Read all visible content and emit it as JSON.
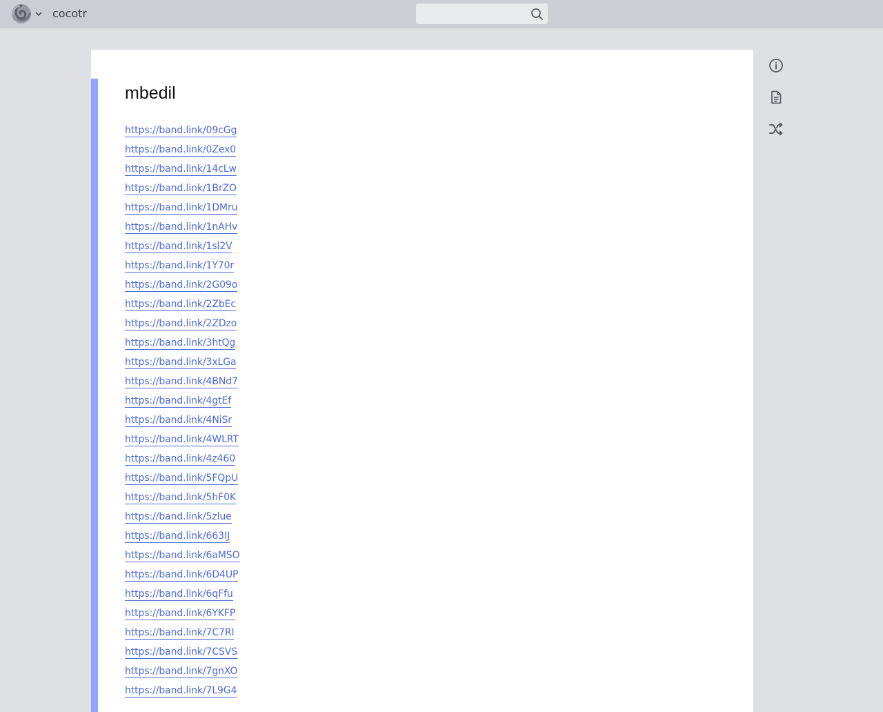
{
  "header": {
    "app_name": "cocotr",
    "logo_icon": "spiral-logo-icon",
    "menu_icon": "chevron-down-icon",
    "search": {
      "value": "",
      "placeholder": "",
      "icon": "search-icon"
    }
  },
  "page": {
    "title": "mbedil",
    "accent_color": "#8fa5ff",
    "link_color": "#4d6bd8",
    "links": [
      "https://band.link/09cGg",
      "https://band.link/0Zex0",
      "https://band.link/14cLw",
      "https://band.link/1BrZO",
      "https://band.link/1DMru",
      "https://band.link/1nAHv",
      "https://band.link/1sl2V",
      "https://band.link/1Y70r",
      "https://band.link/2G09o",
      "https://band.link/2ZbEc",
      "https://band.link/2ZDzo",
      "https://band.link/3htQg",
      "https://band.link/3xLGa",
      "https://band.link/4BNd7",
      "https://band.link/4gtEf",
      "https://band.link/4NiSr",
      "https://band.link/4WLRT",
      "https://band.link/4z460",
      "https://band.link/5FQpU",
      "https://band.link/5hF0K",
      "https://band.link/5zlue",
      "https://band.link/663IJ",
      "https://band.link/6aMSO",
      "https://band.link/6D4UP",
      "https://band.link/6qFfu",
      "https://band.link/6YKFP",
      "https://band.link/7C7RI",
      "https://band.link/7CSVS",
      "https://band.link/7gnXO",
      "https://band.link/7L9G4"
    ]
  },
  "side_tools": [
    "info-icon",
    "document-icon",
    "shuffle-icon"
  ]
}
